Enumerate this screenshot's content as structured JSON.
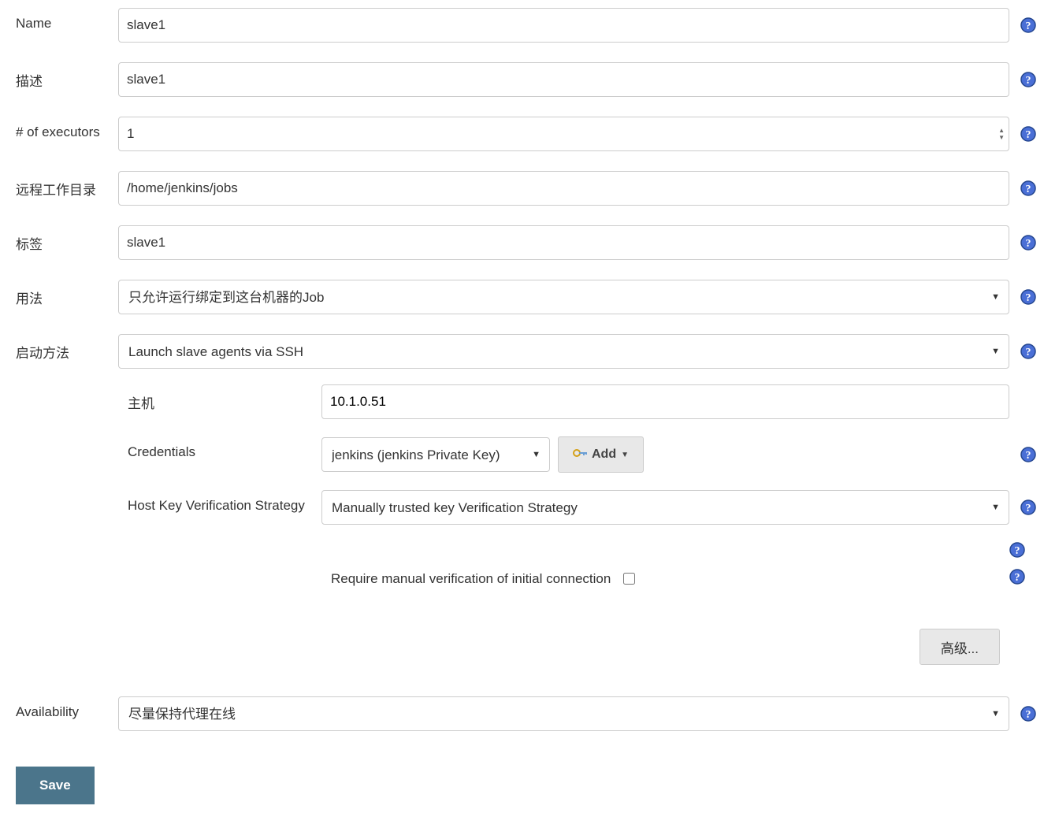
{
  "labels": {
    "name": "Name",
    "description": "描述",
    "executors": "# of executors",
    "remoteDir": "远程工作目录",
    "tags": "标签",
    "usage": "用法",
    "launchMethod": "启动方法",
    "host": "主机",
    "credentials": "Credentials",
    "hostKeyStrategy": "Host Key Verification Strategy",
    "requireManual": "Require manual verification of initial connection",
    "availability": "Availability"
  },
  "values": {
    "name": "slave1",
    "description": "slave1",
    "executors": "1",
    "remoteDir": "/home/jenkins/jobs",
    "tags": "slave1",
    "usage": "只允许运行绑定到这台机器的Job",
    "launchMethod": "Launch slave agents via SSH",
    "host": "10.1.0.51",
    "credentials": "jenkins (jenkins Private Key)",
    "hostKeyStrategy": "Manually trusted key Verification Strategy",
    "requireManualChecked": false,
    "availability": "尽量保持代理在线"
  },
  "buttons": {
    "add": "Add",
    "advanced": "高级...",
    "save": "Save"
  }
}
